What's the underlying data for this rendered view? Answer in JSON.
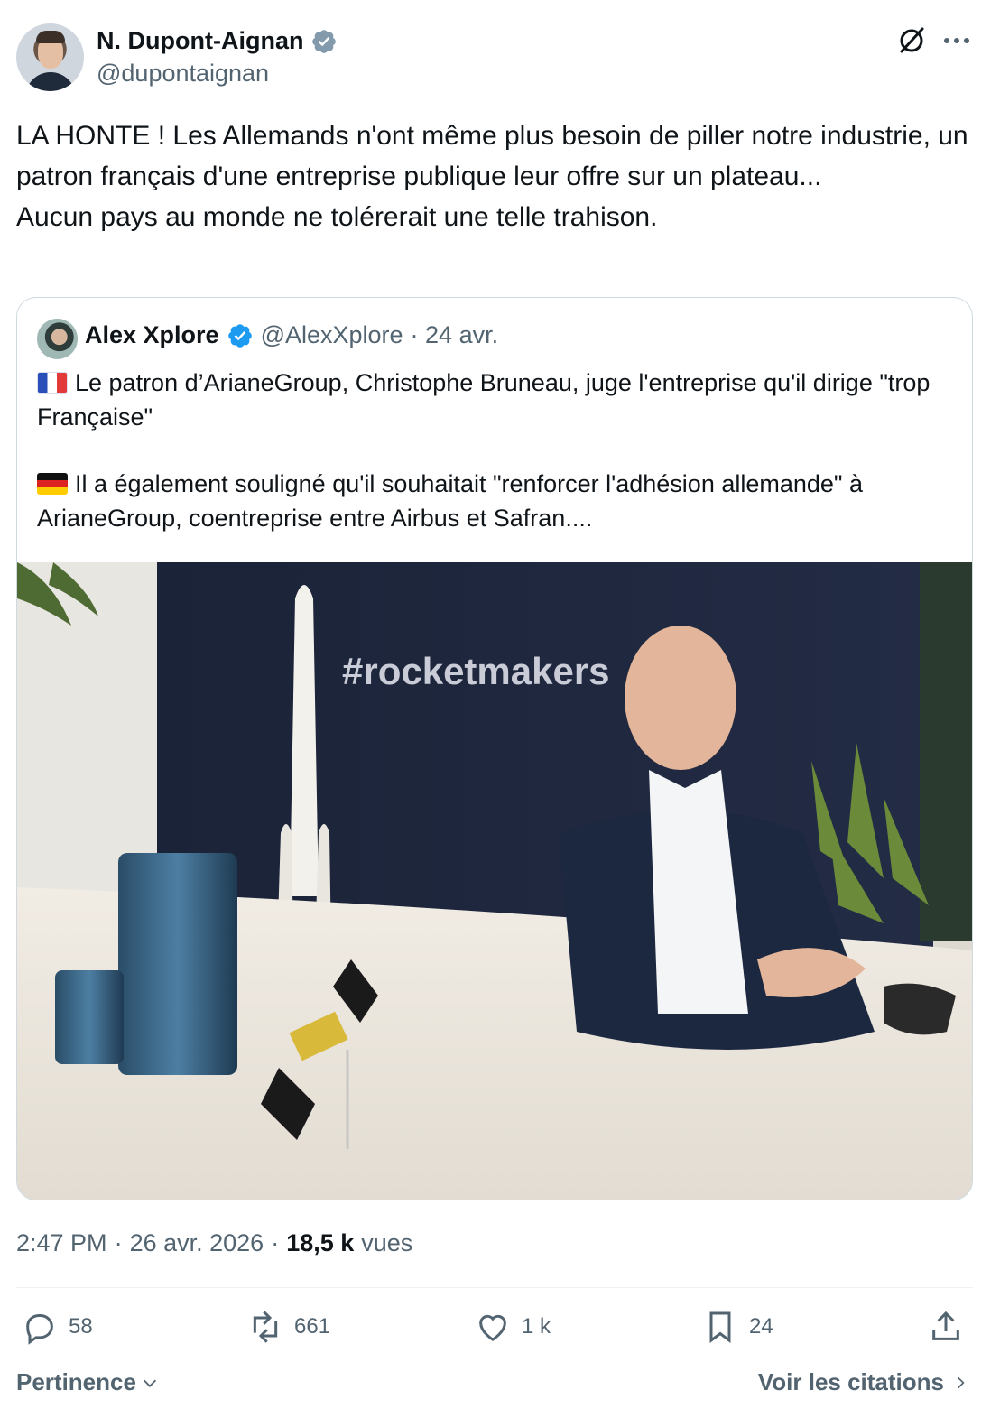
{
  "author": {
    "display_name": "N. Dupont-Aignan",
    "handle": "@dupontaignan"
  },
  "tweet": {
    "text": "LA HONTE ! Les Allemands n'ont même plus besoin de piller notre industrie, un patron français d'une entreprise publique leur offre sur un plateau...\nAucun pays au monde ne tolérerait une telle trahison."
  },
  "quote": {
    "display_name": "Alex Xplore",
    "handle": "@AlexXplore",
    "date": "· 24 avr.",
    "paragraph1": "Le patron d’ArianeGroup, Christophe Bruneau, juge l'entreprise qu'il dirige \"trop Française\"",
    "paragraph2": "Il a également souligné qu'il souhaitait \"renforcer l'adhésion allemande\" à ArianeGroup, coentreprise entre Airbus et Safran....",
    "image_wall_text": "#rocketmakers"
  },
  "meta": {
    "time": "2:47 PM",
    "sep1": "·",
    "date": "26 avr. 2026",
    "sep2": "·",
    "views": "18,5 k",
    "views_label": "vues"
  },
  "actions": {
    "replies": "58",
    "reposts": "661",
    "likes": "1 k",
    "bookmarks": "24"
  },
  "footer": {
    "sort_label": "Pertinence",
    "quotes_link": "Voir les citations"
  },
  "colors": {
    "text": "#0f1419",
    "secondary": "#536471",
    "verified": "#1d9bf0",
    "gov_badge": "#829aab",
    "border": "#cfd9de"
  }
}
